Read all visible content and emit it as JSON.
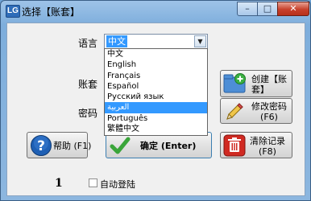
{
  "window": {
    "app_icon": "LG",
    "title": "选择【账套】",
    "controls": {
      "minimize": "–",
      "maximize": "□",
      "close": "✕"
    }
  },
  "form": {
    "language_label": "语言",
    "account_label": "账套",
    "password_label": "密码",
    "language_select": {
      "value": "中文",
      "options": [
        "中文",
        "English",
        "Français",
        "Español",
        "Русский язык",
        "العربية",
        "Português",
        "繁體中文"
      ],
      "highlighted": "العربية"
    }
  },
  "buttons": {
    "create": "创建【账\n套】",
    "change_password": "修改密码\n(F6)",
    "help": "帮助 (F1)",
    "confirm": "确定 (Enter)",
    "clear": "清除记录\n(F8)"
  },
  "footer": {
    "number": "1",
    "auto_login_label": "自动登陆",
    "auto_login_checked": false
  },
  "colors": {
    "titlebar": "#7eaedc",
    "selection": "#3399ff",
    "close_button": "#c7402b",
    "help_icon": "#1e5fb4",
    "confirm_check": "#3aa53a",
    "clear_icon": "#d02a22"
  }
}
